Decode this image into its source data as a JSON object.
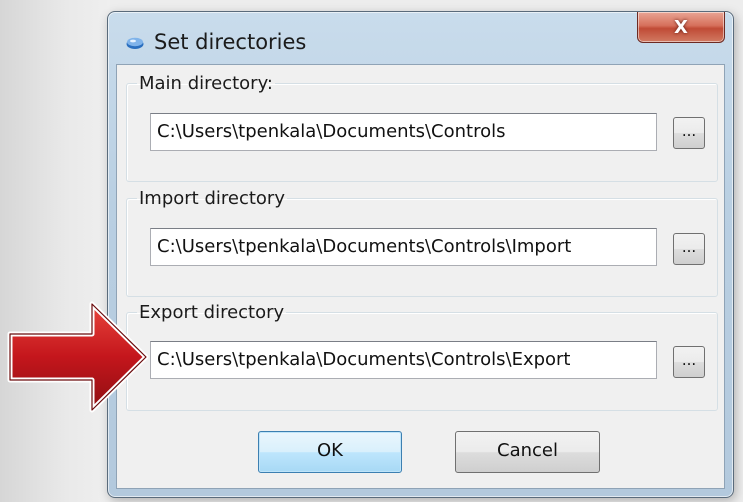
{
  "window": {
    "title": "Set directories",
    "close_glyph": "X"
  },
  "groups": [
    {
      "legend": "Main directory:",
      "path": "C:\\Users\\tpenkala\\Documents\\Controls",
      "browse_label": "..."
    },
    {
      "legend": "Import directory",
      "path": "C:\\Users\\tpenkala\\Documents\\Controls\\Import",
      "browse_label": "..."
    },
    {
      "legend": "Export directory",
      "path": "C:\\Users\\tpenkala\\Documents\\Controls\\Export",
      "browse_label": "..."
    }
  ],
  "buttons": {
    "ok_label": "OK",
    "cancel_label": "Cancel"
  },
  "icons": {
    "window_icon": "app-disc-icon",
    "annotation": "red-arrow-icon"
  },
  "colors": {
    "arrow": "#c0191d",
    "ok_border": "#3c7fb1",
    "close_button": "#c04b36"
  }
}
